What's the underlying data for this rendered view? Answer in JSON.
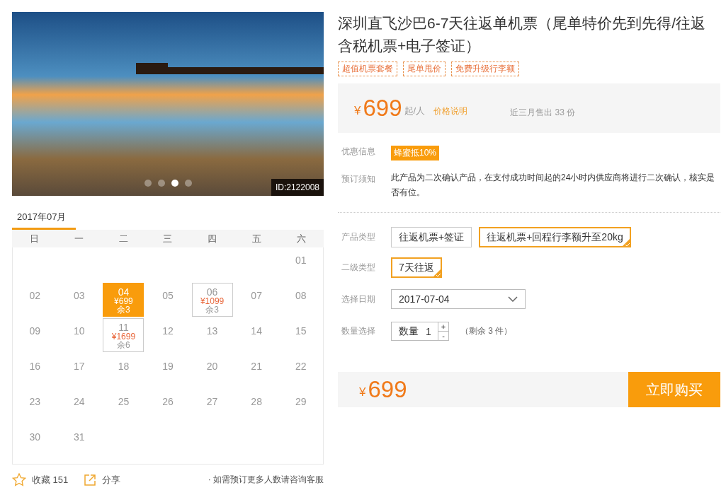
{
  "photo": {
    "id_label": "ID:2122008",
    "slides": [
      {
        "selected": false
      },
      {
        "selected": false
      },
      {
        "selected": true
      },
      {
        "selected": false
      }
    ]
  },
  "calendar": {
    "month_tab": "2017年07月",
    "weekdays": [
      "日",
      "一",
      "二",
      "三",
      "四",
      "五",
      "六"
    ],
    "weeks": [
      [
        {
          "kind": "blank"
        },
        {
          "kind": "blank"
        },
        {
          "kind": "blank"
        },
        {
          "kind": "blank"
        },
        {
          "kind": "blank"
        },
        {
          "kind": "blank"
        },
        {
          "kind": "day",
          "day": "01"
        }
      ],
      [
        {
          "kind": "day",
          "day": "02"
        },
        {
          "kind": "day",
          "day": "03"
        },
        {
          "kind": "priced",
          "day": "04",
          "price": "¥699",
          "remaining": "余3",
          "selected": true
        },
        {
          "kind": "day",
          "day": "05"
        },
        {
          "kind": "priced",
          "day": "06",
          "price": "¥1099",
          "remaining": "余3",
          "selected": false
        },
        {
          "kind": "day",
          "day": "07"
        },
        {
          "kind": "day",
          "day": "08"
        }
      ],
      [
        {
          "kind": "day",
          "day": "09"
        },
        {
          "kind": "day",
          "day": "10"
        },
        {
          "kind": "priced",
          "day": "11",
          "price": "¥1699",
          "remaining": "余6",
          "selected": false
        },
        {
          "kind": "day",
          "day": "12"
        },
        {
          "kind": "day",
          "day": "13"
        },
        {
          "kind": "day",
          "day": "14"
        },
        {
          "kind": "day",
          "day": "15"
        }
      ],
      [
        {
          "kind": "day",
          "day": "16"
        },
        {
          "kind": "day",
          "day": "17"
        },
        {
          "kind": "day",
          "day": "18"
        },
        {
          "kind": "day",
          "day": "19"
        },
        {
          "kind": "day",
          "day": "20"
        },
        {
          "kind": "day",
          "day": "21"
        },
        {
          "kind": "day",
          "day": "22"
        }
      ],
      [
        {
          "kind": "day",
          "day": "23"
        },
        {
          "kind": "day",
          "day": "24"
        },
        {
          "kind": "day",
          "day": "25"
        },
        {
          "kind": "day",
          "day": "26"
        },
        {
          "kind": "day",
          "day": "27"
        },
        {
          "kind": "day",
          "day": "28"
        },
        {
          "kind": "day",
          "day": "29"
        }
      ],
      [
        {
          "kind": "day",
          "day": "30"
        },
        {
          "kind": "day",
          "day": "31"
        },
        {
          "kind": "blank"
        },
        {
          "kind": "blank"
        },
        {
          "kind": "blank"
        },
        {
          "kind": "blank"
        },
        {
          "kind": "blank"
        }
      ]
    ]
  },
  "footer": {
    "favorite": "收藏 151",
    "share": "分享",
    "note": "· 如需预订更多人数请咨询客服"
  },
  "product": {
    "title": "深圳直飞沙巴6-7天往返单机票（尾单特价先到先得/往返含税机票+电子签证）",
    "tags": [
      "超值机票套餐",
      "尾单甩价",
      "免费升级行李额"
    ],
    "price": {
      "currency": "¥",
      "amount": "699",
      "unit": "起/人",
      "link": "价格说明",
      "sales": "近三月售出 33 份"
    },
    "discount": {
      "label": "优惠信息",
      "badge": "蜂蜜抵10%"
    },
    "notice": {
      "label": "预订须知",
      "text": "此产品为二次确认产品，在支付成功时间起的24小时内供应商将进行二次确认，核实是否有位。"
    },
    "product_type": {
      "label": "产品类型",
      "choices": [
        {
          "label": "往返机票+签证",
          "selected": false
        },
        {
          "label": "往返机票+回程行李额升至20kg",
          "selected": true
        }
      ]
    },
    "sub_type": {
      "label": "二级类型",
      "choices": [
        {
          "label": "7天往返",
          "selected": true
        }
      ]
    },
    "date": {
      "label": "选择日期",
      "value": "2017-07-04"
    },
    "quantity": {
      "label": "数量选择",
      "field_label": "数量",
      "value": "1",
      "plus": "+",
      "minus": "-",
      "note": "（剩余 3 件）"
    }
  },
  "purchase": {
    "currency": "¥",
    "amount": "699",
    "button": "立即购买"
  }
}
